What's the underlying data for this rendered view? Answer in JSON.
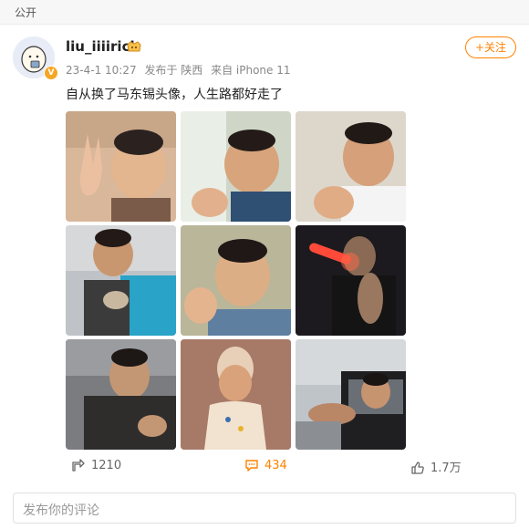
{
  "visibility": "公开",
  "user": {
    "name": "liu_iiiirich",
    "verified_mark": "V"
  },
  "post": {
    "date": "23-4-1 10:27",
    "location": "发布于 陕西",
    "device": "来自 iPhone 11",
    "text": "自从换了马东锡头像，人生路都好走了"
  },
  "follow_label": "+关注",
  "photos": [
    {
      "id": 1,
      "desc": "peace-sign"
    },
    {
      "id": 2,
      "desc": "finger-heart"
    },
    {
      "id": 3,
      "desc": "fist"
    },
    {
      "id": 4,
      "desc": "holding-kitten"
    },
    {
      "id": 5,
      "desc": "finger-heart-selfie"
    },
    {
      "id": 6,
      "desc": "light-stick"
    },
    {
      "id": 7,
      "desc": "movie-still"
    },
    {
      "id": 8,
      "desc": "bib"
    },
    {
      "id": 9,
      "desc": "car-window"
    }
  ],
  "actions": {
    "repost_count": "1210",
    "comment_count": "434",
    "like_count": "1.7万"
  },
  "comment_placeholder": "发布你的评论",
  "colors": {
    "accent": "#ff8200",
    "badge": "#f5a623"
  }
}
